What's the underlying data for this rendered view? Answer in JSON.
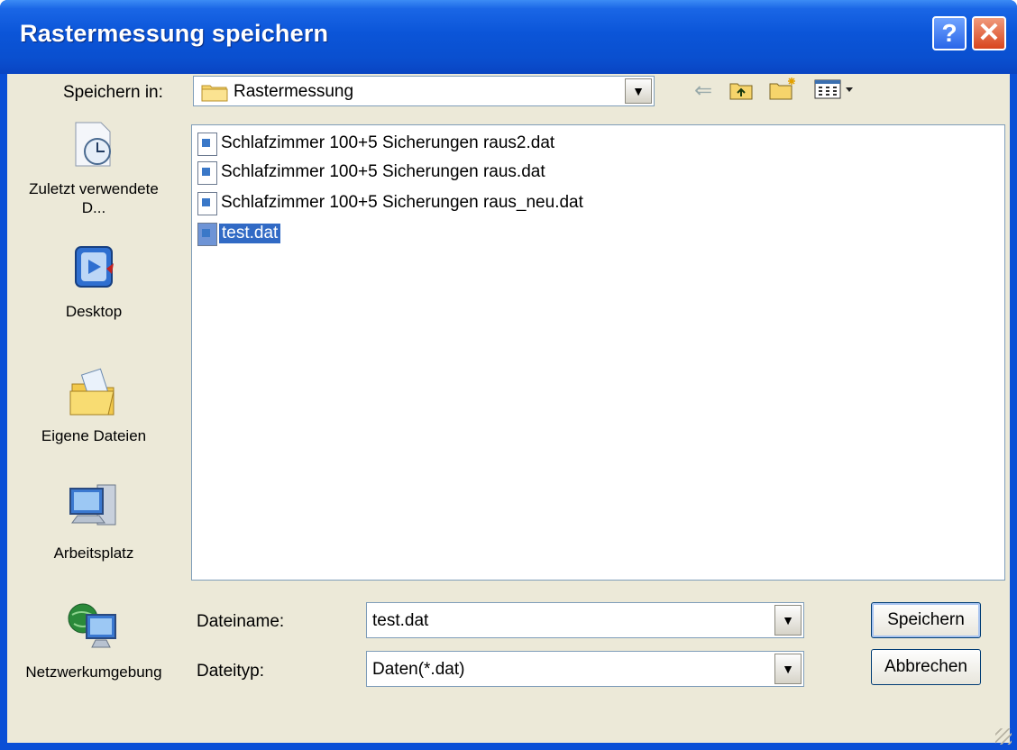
{
  "window": {
    "title": "Rastermessung speichern"
  },
  "save_in": {
    "label": "Speichern in:",
    "folder": "Rastermessung"
  },
  "places": [
    {
      "label": "Zuletzt verwendete D...",
      "icon": "recent-documents-icon"
    },
    {
      "label": "Desktop",
      "icon": "desktop-icon"
    },
    {
      "label": "Eigene Dateien",
      "icon": "my-documents-icon"
    },
    {
      "label": "Arbeitsplatz",
      "icon": "my-computer-icon"
    },
    {
      "label": "Netzwerkumgebung",
      "icon": "network-icon"
    }
  ],
  "files": [
    {
      "name": "Schlafzimmer 100+5 Sicherungen raus2.dat",
      "selected": false
    },
    {
      "name": "Schlafzimmer 100+5 Sicherungen raus.dat",
      "selected": false
    },
    {
      "name": "Schlafzimmer 100+5 Sicherungen raus_neu.dat",
      "selected": false
    },
    {
      "name": "test.dat",
      "selected": true
    }
  ],
  "filename": {
    "label": "Dateiname:",
    "value": "test.dat"
  },
  "filetype": {
    "label": "Dateityp:",
    "value": "Daten(*.dat)"
  },
  "buttons": {
    "save": "Speichern",
    "cancel": "Abbrechen"
  },
  "colors": {
    "titlebar": "#0a4fd6",
    "selection": "#316ac5",
    "dialog_bg": "#ece9d8"
  }
}
